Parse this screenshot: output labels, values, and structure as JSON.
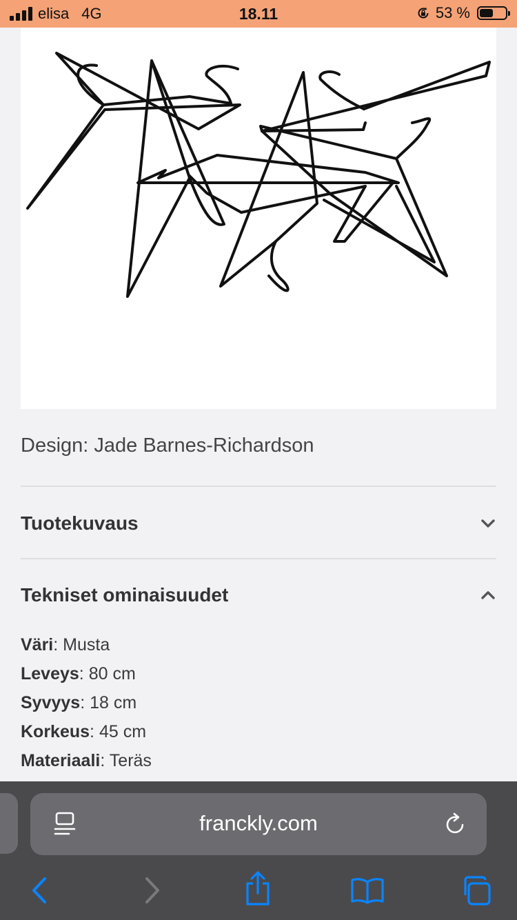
{
  "status_bar": {
    "carrier": "elisa",
    "network": "4G",
    "time": "18.11",
    "battery_text": "53 %",
    "battery_level": 0.53
  },
  "product": {
    "image_description_icon": "wire-hangers-image",
    "designer": "Design: Jade Barnes-Richardson"
  },
  "sections": [
    {
      "title": "Tuotekuvaus",
      "expanded": false,
      "icon": "chevron-down-icon"
    },
    {
      "title": "Tekniset ominaisuudet",
      "expanded": true,
      "icon": "chevron-up-icon"
    }
  ],
  "specs": [
    {
      "label": "Väri",
      "value": ": Musta"
    },
    {
      "label": "Leveys",
      "value": ": 80 cm"
    },
    {
      "label": "Syvyys",
      "value": ": 18 cm"
    },
    {
      "label": "Korkeus",
      "value": ": 45 cm"
    },
    {
      "label": "Materiaali",
      "value": ": Teräs"
    }
  ],
  "browser": {
    "url": "franckly.com",
    "accent_color": "#0a84ff",
    "toolbar": [
      "back-icon",
      "forward-icon",
      "share-icon",
      "bookmarks-icon",
      "tabs-icon"
    ]
  }
}
